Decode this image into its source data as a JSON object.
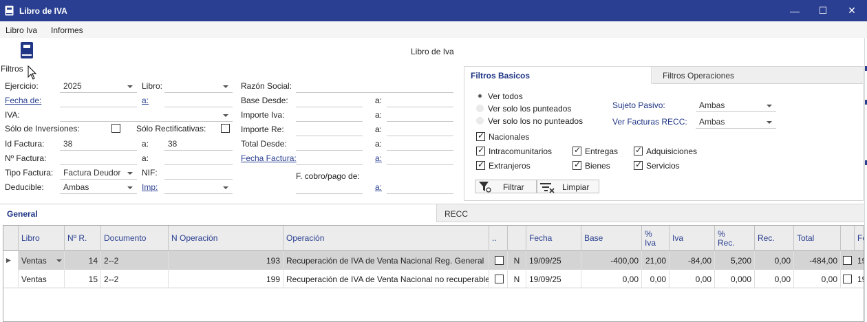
{
  "window": {
    "title": "Libro de IVA",
    "app_icon": "book-icon"
  },
  "window_controls": {
    "minimize": "—",
    "maximize": "☐",
    "close": "✕"
  },
  "menu": {
    "items": [
      "Libro Iva",
      "Informes"
    ]
  },
  "toolbar": {
    "section_title": "Libro de Iva",
    "filters_label": "Filtros",
    "filters_icon": "book-icon"
  },
  "form": {
    "ejercicio": {
      "label": "Ejercicio:",
      "value": "2025"
    },
    "libro": {
      "label": "Libro:",
      "value": ""
    },
    "razon_social": {
      "label": "Razón Social:",
      "value": ""
    },
    "fecha_de": {
      "label": "Fecha de:",
      "value": "",
      "to_label": "a:",
      "to_value": ""
    },
    "base_desde": {
      "label": "Base Desde:",
      "value": "",
      "to_label": "a:",
      "to_value": ""
    },
    "iva": {
      "label": "IVA:",
      "value": ""
    },
    "importe_iva": {
      "label": "Importe Iva:",
      "value": "",
      "to_label": "a:",
      "to_value": ""
    },
    "solo_inversiones": {
      "label": "Sólo de Inversiones:",
      "checked": false
    },
    "solo_rectificativas": {
      "label": "Sólo Rectificativas:",
      "checked": false
    },
    "importe_re": {
      "label": "Importe Re:",
      "value": "",
      "to_label": "a:",
      "to_value": ""
    },
    "id_factura": {
      "label": "Id Factura:",
      "value": "38",
      "to_label": "a:",
      "to_value": "38"
    },
    "total_desde": {
      "label": "Total Desde:",
      "value": "",
      "to_label": "a:",
      "to_value": ""
    },
    "n_factura": {
      "label": "Nº Factura:",
      "value": "",
      "to_label": "a:",
      "to_value": ""
    },
    "fecha_factura": {
      "label": "Fecha Factura:",
      "value": "",
      "to_label": "a:",
      "to_value": ""
    },
    "tipo_factura": {
      "label": "Tipo Factura:",
      "value": "Factura Deudor"
    },
    "nif": {
      "label": "NIF:",
      "value": ""
    },
    "fcobro": {
      "label": "F. cobro/pago de:",
      "value": "",
      "to_label": "a:",
      "to_value": ""
    },
    "deducible": {
      "label": "Deducible:",
      "value": "Ambas"
    },
    "imp": {
      "label": "Imp:",
      "value": ""
    }
  },
  "filter_tabs": {
    "basic": "Filtros Basicos",
    "operations": "Filtros Operaciones"
  },
  "filters_basic": {
    "radios": [
      {
        "label": "Ver todos",
        "selected": true
      },
      {
        "label": "Ver solo los punteados",
        "selected": false
      },
      {
        "label": "Ver solo los no punteados",
        "selected": false
      }
    ],
    "sujeto_pasivo": {
      "label": "Sujeto Pasivo:",
      "value": "Ambas"
    },
    "ver_facturas_recc": {
      "label": "Ver Facturas RECC:",
      "value": "Ambas"
    },
    "checks": {
      "nacionales": {
        "label": "Nacionales",
        "checked": true
      },
      "intracomunitarios": {
        "label": "Intracomunitarios",
        "checked": true
      },
      "entregas": {
        "label": "Entregas",
        "checked": true
      },
      "adquisiciones": {
        "label": "Adquisiciones",
        "checked": true
      },
      "extranjeros": {
        "label": "Extranjeros",
        "checked": true
      },
      "bienes": {
        "label": "Bienes",
        "checked": true
      },
      "servicios": {
        "label": "Servicios",
        "checked": true
      }
    },
    "buttons": {
      "filtrar": "Filtrar",
      "limpiar": "Limpiar"
    }
  },
  "bottom_tabs": {
    "general": "General",
    "recc": "RECC"
  },
  "grid": {
    "columns": [
      "Libro",
      "Nº R.",
      "Documento",
      "N Operación",
      "Operación",
      "..",
      "",
      "Fecha",
      "Base",
      "%\nIva",
      "Iva",
      "%\nRec.",
      "Rec.",
      "Total",
      "",
      "Fe"
    ],
    "rows": [
      {
        "libro": "Ventas",
        "nr": "14",
        "documento": "2--2",
        "n_operacion": "193",
        "operacion": "Recuperación de IVA de Venta Nacional Reg. General",
        "flag": "N",
        "fecha": "19/09/25",
        "base": "-400,00",
        "pct_iva": "21,00",
        "iva": "-84,00",
        "pct_rec": "5,200",
        "rec": "0,00",
        "total": "-484,00",
        "fe": "19"
      },
      {
        "libro": "Ventas",
        "nr": "15",
        "documento": "2--2",
        "n_operacion": "199",
        "operacion": "Recuperación de IVA de Venta Nacional no recuperable",
        "flag": "N",
        "fecha": "19/09/25",
        "base": "0,00",
        "pct_iva": "0,00",
        "iva": "0,00",
        "pct_rec": "0,000",
        "rec": "0,00",
        "total": "0,00",
        "fe": "19"
      }
    ]
  },
  "colors": {
    "titlebar": "#2a3f91",
    "accent": "#2a3f91",
    "selected_row": "#d4d4d4"
  }
}
